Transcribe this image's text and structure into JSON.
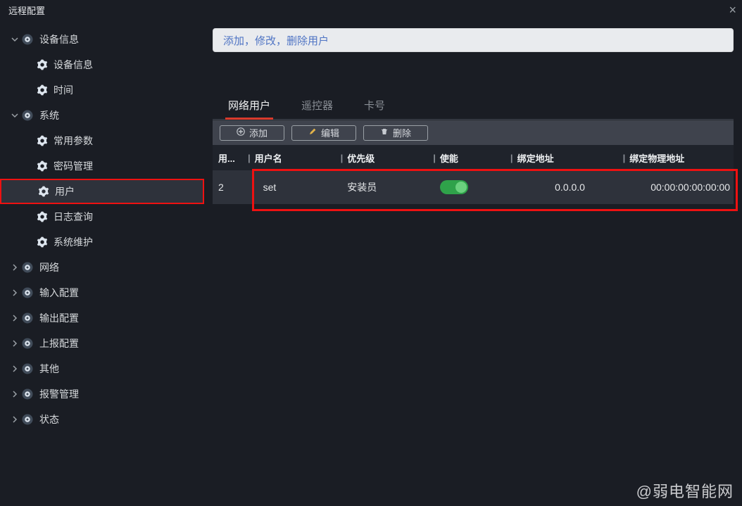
{
  "window": {
    "title": "远程配置"
  },
  "sidebar": {
    "groups": [
      {
        "label": "设备信息",
        "expanded": true,
        "children": [
          {
            "label": "设备信息"
          },
          {
            "label": "时间"
          }
        ]
      },
      {
        "label": "系统",
        "expanded": true,
        "children": [
          {
            "label": "常用参数"
          },
          {
            "label": "密码管理"
          },
          {
            "label": "用户",
            "selected": true
          },
          {
            "label": "日志查询"
          },
          {
            "label": "系统维护"
          }
        ]
      },
      {
        "label": "网络",
        "expanded": false
      },
      {
        "label": "输入配置",
        "expanded": false
      },
      {
        "label": "输出配置",
        "expanded": false
      },
      {
        "label": "上报配置",
        "expanded": false
      },
      {
        "label": "其他",
        "expanded": false
      },
      {
        "label": "报警管理",
        "expanded": false
      },
      {
        "label": "状态",
        "expanded": false
      }
    ]
  },
  "banner": {
    "text": "添加，修改，删除用户"
  },
  "tabs": {
    "items": [
      {
        "label": "网络用户",
        "active": true
      },
      {
        "label": "遥控器",
        "active": false
      },
      {
        "label": "卡号",
        "active": false
      }
    ]
  },
  "toolbar": {
    "add": "添加",
    "edit": "编辑",
    "delete": "删除"
  },
  "table": {
    "headers": {
      "index": "用...",
      "username": "用户名",
      "priority": "优先级",
      "enable": "使能",
      "bind_ip": "绑定地址",
      "bind_mac": "绑定物理地址"
    },
    "rows": [
      {
        "index": "2",
        "username": "set",
        "priority": "安装员",
        "enable": true,
        "bind_ip": "0.0.0.0",
        "bind_mac": "00:00:00:00:00:00"
      }
    ]
  },
  "watermark": "@弱电智能网"
}
